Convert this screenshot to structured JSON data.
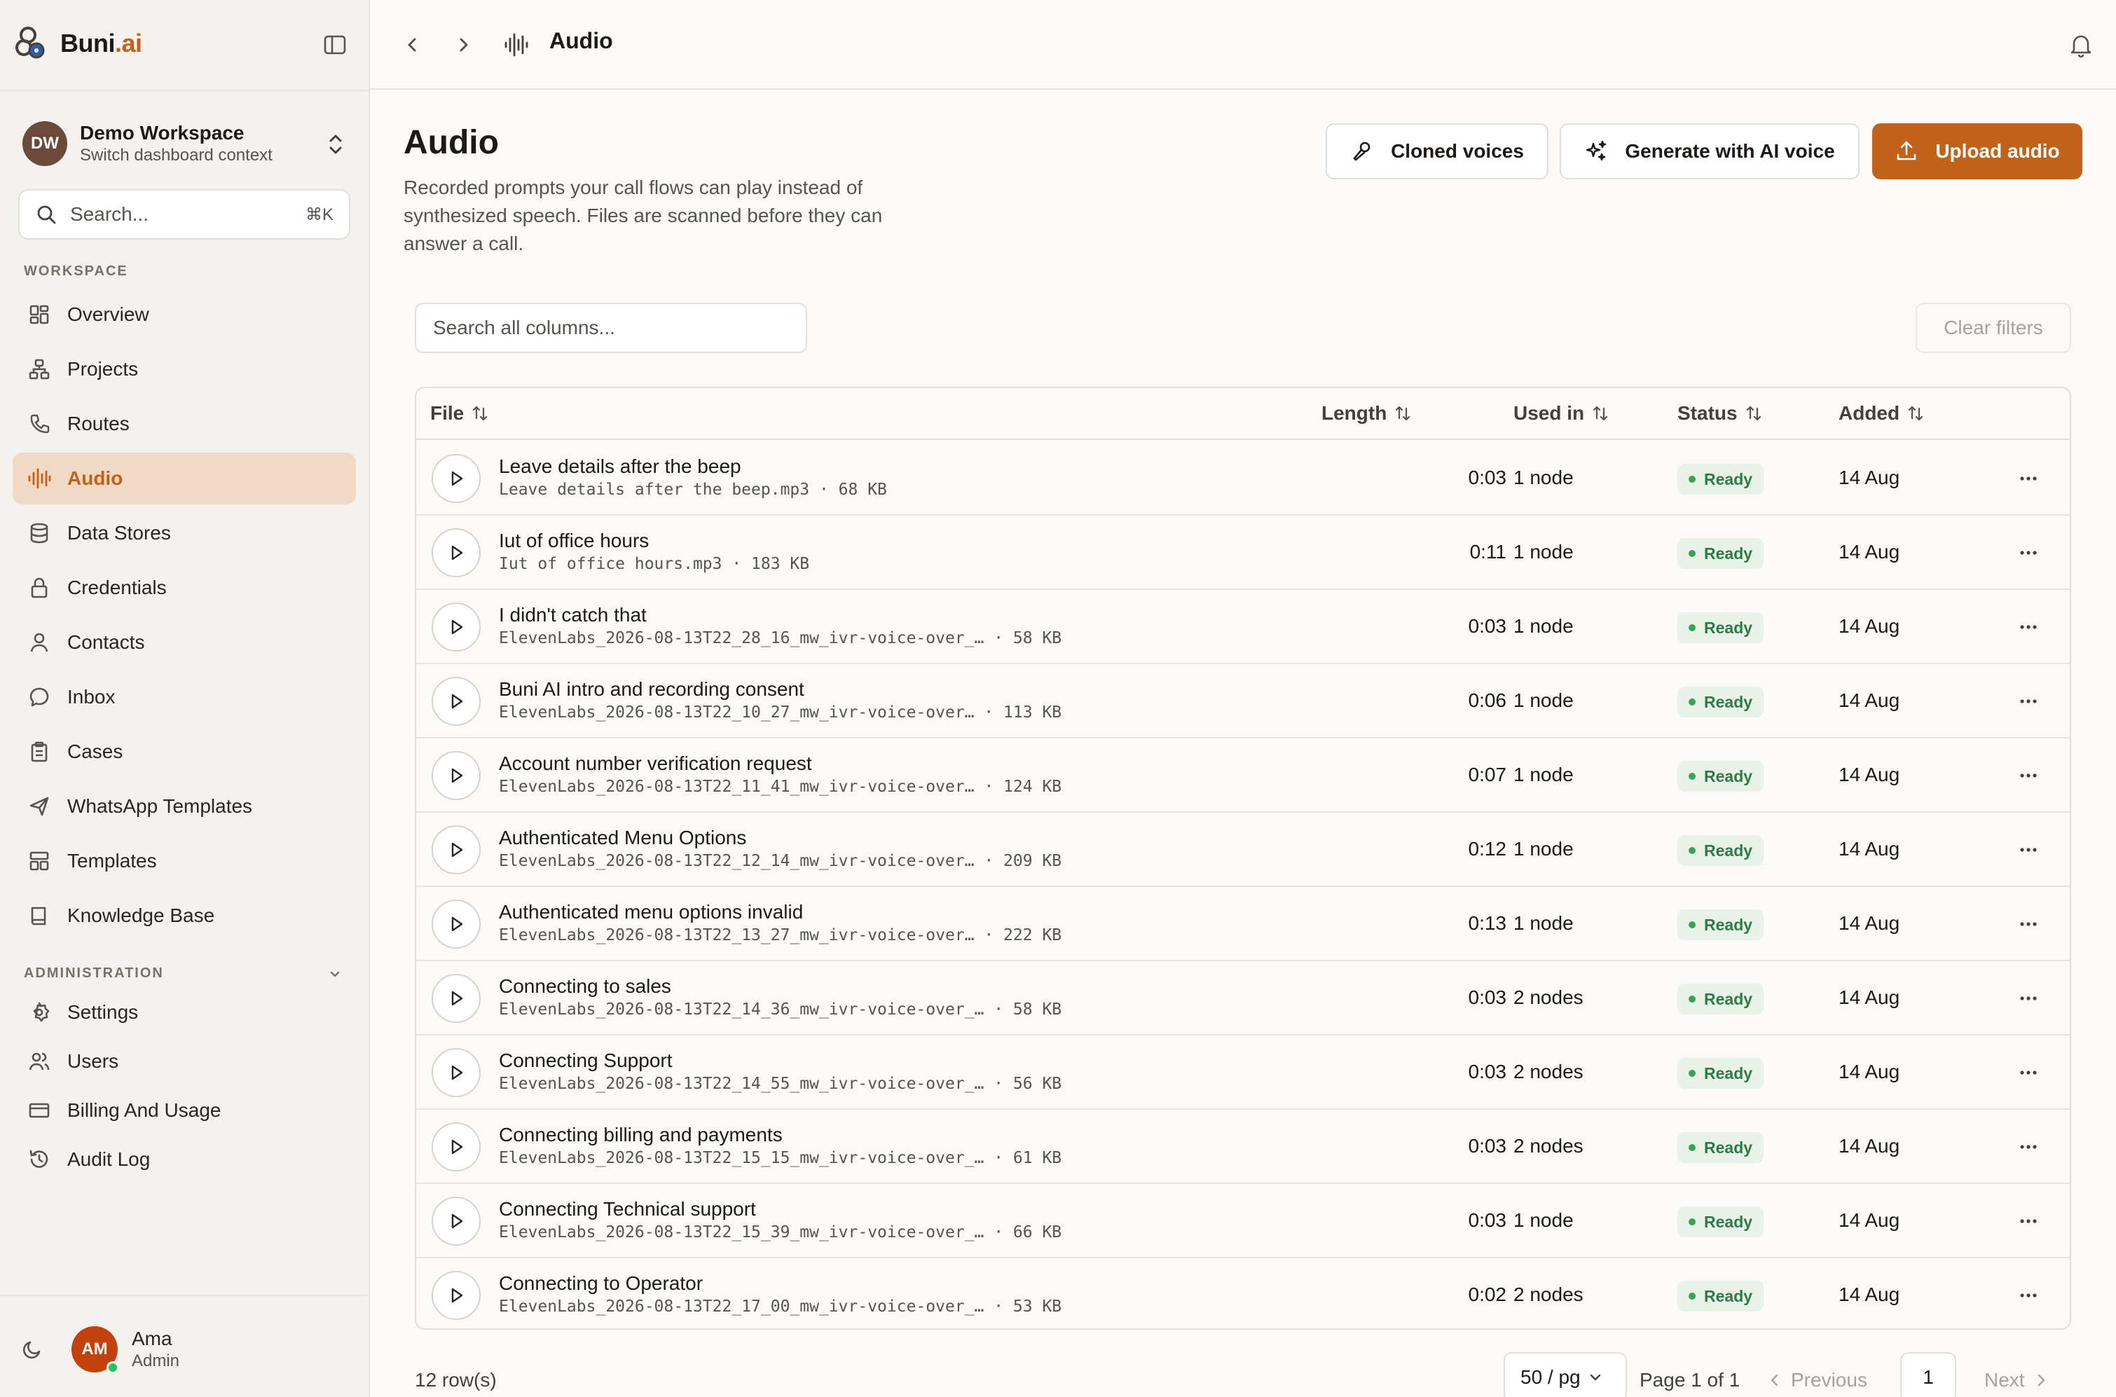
{
  "brand": {
    "name": "Buni",
    "tld": ".ai"
  },
  "workspace": {
    "initials": "DW",
    "name": "Demo Workspace",
    "subtitle": "Switch dashboard context"
  },
  "sidebar_search": {
    "placeholder": "Search...",
    "shortcut": "⌘K"
  },
  "sections": {
    "workspace": "WORKSPACE",
    "administration": "ADMINISTRATION"
  },
  "nav": {
    "overview": "Overview",
    "projects": "Projects",
    "routes": "Routes",
    "audio": "Audio",
    "data_stores": "Data Stores",
    "credentials": "Credentials",
    "contacts": "Contacts",
    "inbox": "Inbox",
    "cases": "Cases",
    "whatsapp_templates": "WhatsApp Templates",
    "templates": "Templates",
    "knowledge_base": "Knowledge Base",
    "settings": "Settings",
    "users": "Users",
    "billing": "Billing And Usage",
    "audit_log": "Audit Log"
  },
  "user": {
    "initials": "AM",
    "name": "Ama",
    "role": "Admin"
  },
  "topbar": {
    "title": "Audio"
  },
  "page": {
    "title": "Audio",
    "description": "Recorded prompts your call flows can play instead of synthesized speech. Files are scanned before they can answer a call."
  },
  "actions": {
    "cloned": "Cloned voices",
    "generate": "Generate with AI voice",
    "upload": "Upload audio"
  },
  "table_search": {
    "placeholder": "Search all columns..."
  },
  "clear_filters": "Clear filters",
  "columns": {
    "file": "File",
    "length": "Length",
    "used_in": "Used in",
    "status": "Status",
    "added": "Added"
  },
  "rows": [
    {
      "name": "Leave details after the beep",
      "file": "Leave details after the beep.mp3 · 68 KB",
      "length": "0:03",
      "used_in": "1 node",
      "status": "Ready",
      "added": "14 Aug"
    },
    {
      "name": "Iut of office hours",
      "file": "Iut of office hours.mp3 · 183 KB",
      "length": "0:11",
      "used_in": "1 node",
      "status": "Ready",
      "added": "14 Aug"
    },
    {
      "name": "I didn't catch that",
      "file": "ElevenLabs_2026-08-13T22_28_16_mw_ivr-voice-over_… · 58 KB",
      "length": "0:03",
      "used_in": "1 node",
      "status": "Ready",
      "added": "14 Aug"
    },
    {
      "name": "Buni AI intro and recording consent",
      "file": "ElevenLabs_2026-08-13T22_10_27_mw_ivr-voice-over… · 113 KB",
      "length": "0:06",
      "used_in": "1 node",
      "status": "Ready",
      "added": "14 Aug"
    },
    {
      "name": "Account number verification request",
      "file": "ElevenLabs_2026-08-13T22_11_41_mw_ivr-voice-over… · 124 KB",
      "length": "0:07",
      "used_in": "1 node",
      "status": "Ready",
      "added": "14 Aug"
    },
    {
      "name": "Authenticated Menu Options",
      "file": "ElevenLabs_2026-08-13T22_12_14_mw_ivr-voice-over… · 209 KB",
      "length": "0:12",
      "used_in": "1 node",
      "status": "Ready",
      "added": "14 Aug"
    },
    {
      "name": "Authenticated menu options invalid",
      "file": "ElevenLabs_2026-08-13T22_13_27_mw_ivr-voice-over… · 222 KB",
      "length": "0:13",
      "used_in": "1 node",
      "status": "Ready",
      "added": "14 Aug"
    },
    {
      "name": "Connecting to sales",
      "file": "ElevenLabs_2026-08-13T22_14_36_mw_ivr-voice-over_… · 58 KB",
      "length": "0:03",
      "used_in": "2 nodes",
      "status": "Ready",
      "added": "14 Aug"
    },
    {
      "name": "Connecting Support",
      "file": "ElevenLabs_2026-08-13T22_14_55_mw_ivr-voice-over_… · 56 KB",
      "length": "0:03",
      "used_in": "2 nodes",
      "status": "Ready",
      "added": "14 Aug"
    },
    {
      "name": "Connecting billing and payments",
      "file": "ElevenLabs_2026-08-13T22_15_15_mw_ivr-voice-over_… · 61 KB",
      "length": "0:03",
      "used_in": "2 nodes",
      "status": "Ready",
      "added": "14 Aug"
    },
    {
      "name": "Connecting Technical support",
      "file": "ElevenLabs_2026-08-13T22_15_39_mw_ivr-voice-over_… · 66 KB",
      "length": "0:03",
      "used_in": "1 node",
      "status": "Ready",
      "added": "14 Aug"
    },
    {
      "name": "Connecting to Operator",
      "file": "ElevenLabs_2026-08-13T22_17_00_mw_ivr-voice-over_… · 53 KB",
      "length": "0:02",
      "used_in": "2 nodes",
      "status": "Ready",
      "added": "14 Aug"
    }
  ],
  "footer": {
    "row_count": "12 row(s)",
    "page_size": "50 / pg",
    "page_of": "Page 1 of 1",
    "previous": "Previous",
    "current_page": "1",
    "next": "Next"
  },
  "colors": {
    "accent": "#c2611a",
    "active_bg": "#f1d9c6",
    "ready_bg": "#e8f2e9",
    "ready_text": "#2f7a45"
  }
}
